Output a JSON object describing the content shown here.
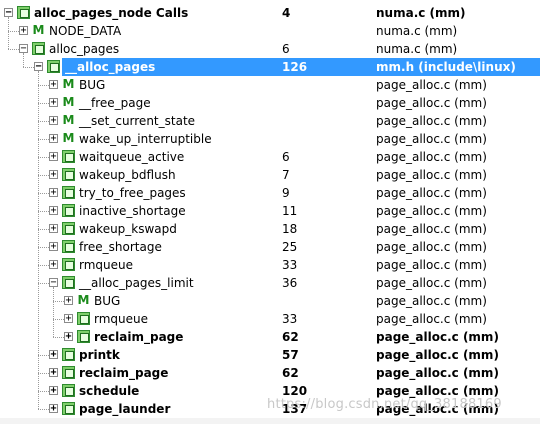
{
  "tree": {
    "rows": [
      {
        "name": "alloc_pages_node Calls",
        "calls": "4",
        "file": "numa.c (mm)",
        "depth": 0,
        "icon": "function-icon",
        "expander": "minus",
        "bold": true
      },
      {
        "name": "NODE_DATA",
        "calls": "",
        "file": "numa.c (mm)",
        "depth": 1,
        "icon": "macro-icon",
        "expander": "plus"
      },
      {
        "name": "alloc_pages",
        "calls": "6",
        "file": "numa.c (mm)",
        "depth": 1,
        "icon": "function-icon",
        "expander": "minus"
      },
      {
        "name": "__alloc_pages",
        "calls": "126",
        "file": "mm.h (include\\linux)",
        "depth": 2,
        "icon": "function-icon",
        "expander": "minus",
        "bold": true,
        "selected": true
      },
      {
        "name": "BUG",
        "calls": "",
        "file": "page_alloc.c (mm)",
        "depth": 3,
        "icon": "macro-icon",
        "expander": "plus"
      },
      {
        "name": "__free_page",
        "calls": "",
        "file": "page_alloc.c (mm)",
        "depth": 3,
        "icon": "macro-icon",
        "expander": "plus"
      },
      {
        "name": "__set_current_state",
        "calls": "",
        "file": "page_alloc.c (mm)",
        "depth": 3,
        "icon": "macro-icon",
        "expander": "plus"
      },
      {
        "name": "wake_up_interruptible",
        "calls": "",
        "file": "page_alloc.c (mm)",
        "depth": 3,
        "icon": "macro-icon",
        "expander": "plus"
      },
      {
        "name": "waitqueue_active",
        "calls": "6",
        "file": "page_alloc.c (mm)",
        "depth": 3,
        "icon": "function-icon",
        "expander": "plus"
      },
      {
        "name": "wakeup_bdflush",
        "calls": "7",
        "file": "page_alloc.c (mm)",
        "depth": 3,
        "icon": "function-icon",
        "expander": "plus"
      },
      {
        "name": "try_to_free_pages",
        "calls": "9",
        "file": "page_alloc.c (mm)",
        "depth": 3,
        "icon": "function-icon",
        "expander": "plus"
      },
      {
        "name": "inactive_shortage",
        "calls": "11",
        "file": "page_alloc.c (mm)",
        "depth": 3,
        "icon": "function-icon",
        "expander": "plus"
      },
      {
        "name": "wakeup_kswapd",
        "calls": "18",
        "file": "page_alloc.c (mm)",
        "depth": 3,
        "icon": "function-icon",
        "expander": "plus"
      },
      {
        "name": "free_shortage",
        "calls": "25",
        "file": "page_alloc.c (mm)",
        "depth": 3,
        "icon": "function-icon",
        "expander": "plus"
      },
      {
        "name": "rmqueue",
        "calls": "33",
        "file": "page_alloc.c (mm)",
        "depth": 3,
        "icon": "function-icon",
        "expander": "plus"
      },
      {
        "name": "__alloc_pages_limit",
        "calls": "36",
        "file": "page_alloc.c (mm)",
        "depth": 3,
        "icon": "function-icon",
        "expander": "minus"
      },
      {
        "name": "BUG",
        "calls": "",
        "file": "page_alloc.c (mm)",
        "depth": 4,
        "icon": "macro-icon",
        "expander": "plus"
      },
      {
        "name": "rmqueue",
        "calls": "33",
        "file": "page_alloc.c (mm)",
        "depth": 4,
        "icon": "function-icon",
        "expander": "plus"
      },
      {
        "name": "reclaim_page",
        "calls": "62",
        "file": "page_alloc.c (mm)",
        "depth": 4,
        "icon": "function-icon",
        "expander": "plus",
        "bold": true
      },
      {
        "name": "printk",
        "calls": "57",
        "file": "page_alloc.c (mm)",
        "depth": 3,
        "icon": "function-icon",
        "expander": "plus",
        "bold": true
      },
      {
        "name": "reclaim_page",
        "calls": "62",
        "file": "page_alloc.c (mm)",
        "depth": 3,
        "icon": "function-icon",
        "expander": "plus",
        "bold": true
      },
      {
        "name": "schedule",
        "calls": "120",
        "file": "page_alloc.c (mm)",
        "depth": 3,
        "icon": "function-icon",
        "expander": "plus",
        "bold": true
      },
      {
        "name": "page_launder",
        "calls": "137",
        "file": "page_alloc.c (mm)",
        "depth": 3,
        "icon": "function-icon",
        "expander": "plus",
        "bold": true
      }
    ]
  },
  "watermark": "https://blog.csdn.net/qq_38188169",
  "colors": {
    "selection": "#3399ff",
    "function_icon": "#7fcf6b",
    "macro_icon": "#1a8a1a"
  }
}
